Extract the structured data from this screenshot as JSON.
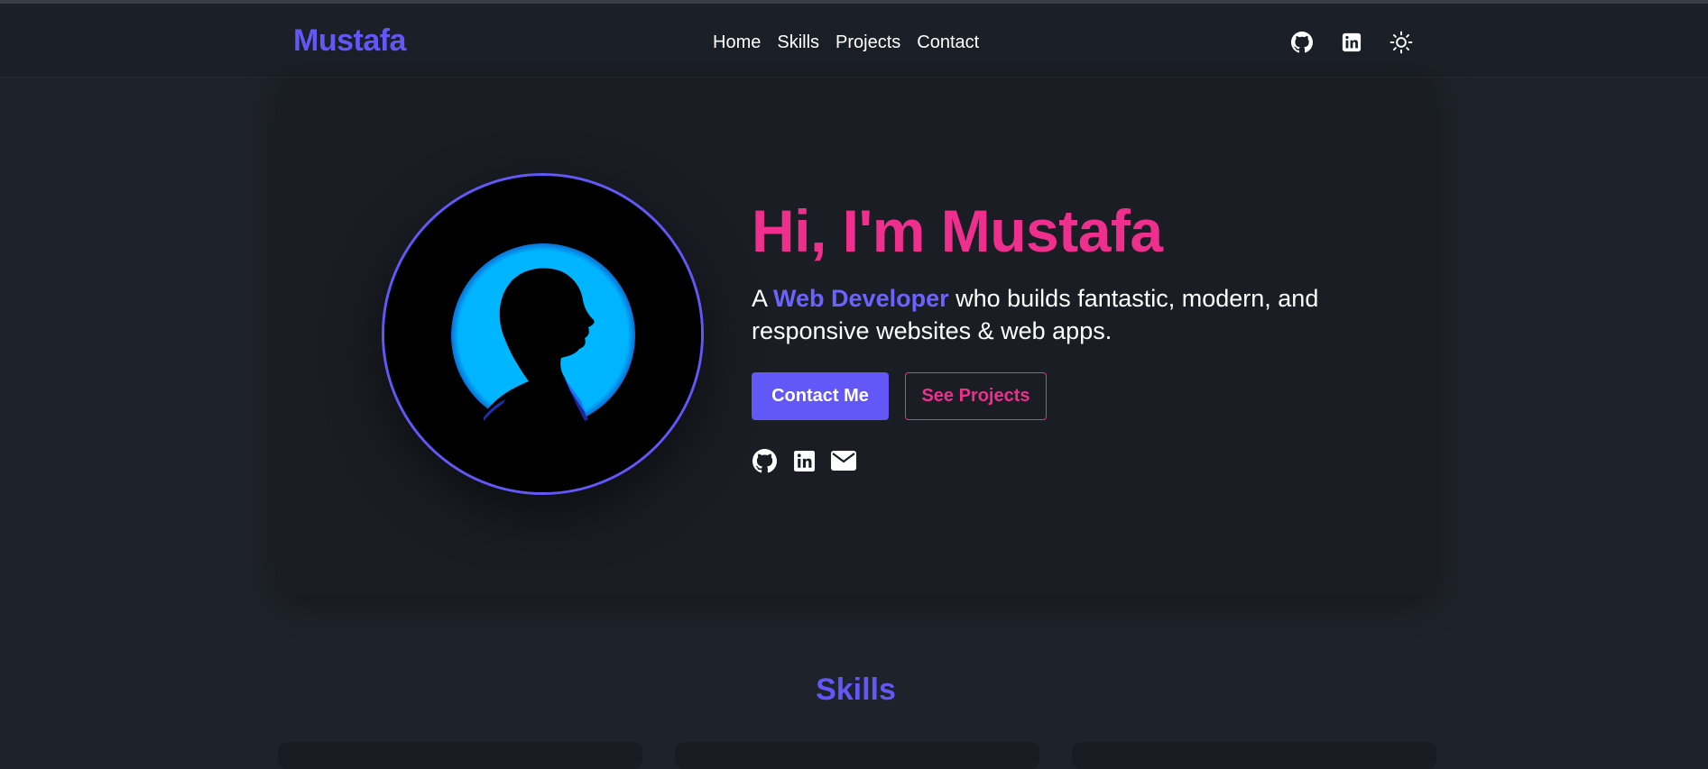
{
  "navbar": {
    "brand": "Mustafa",
    "links": [
      "Home",
      "Skills",
      "Projects",
      "Contact"
    ],
    "icons": [
      "github-icon",
      "linkedin-icon",
      "sun-icon"
    ]
  },
  "hero": {
    "title": "Hi, I'm Mustafa",
    "subtitle_prefix": "A ",
    "subtitle_highlight": "Web Developer",
    "subtitle_rest": " who builds fantastic, modern, and responsive websites & web apps.",
    "primary_button": "Contact Me",
    "secondary_button": "See Projects",
    "social_icons": [
      "github-icon",
      "linkedin-icon",
      "envelope-icon"
    ]
  },
  "skills": {
    "title": "Skills"
  },
  "colors": {
    "accent": "#6257f7",
    "pink": "#ef2f8d",
    "background": "#1e222a",
    "avatar_glow": "#00b4ff"
  }
}
